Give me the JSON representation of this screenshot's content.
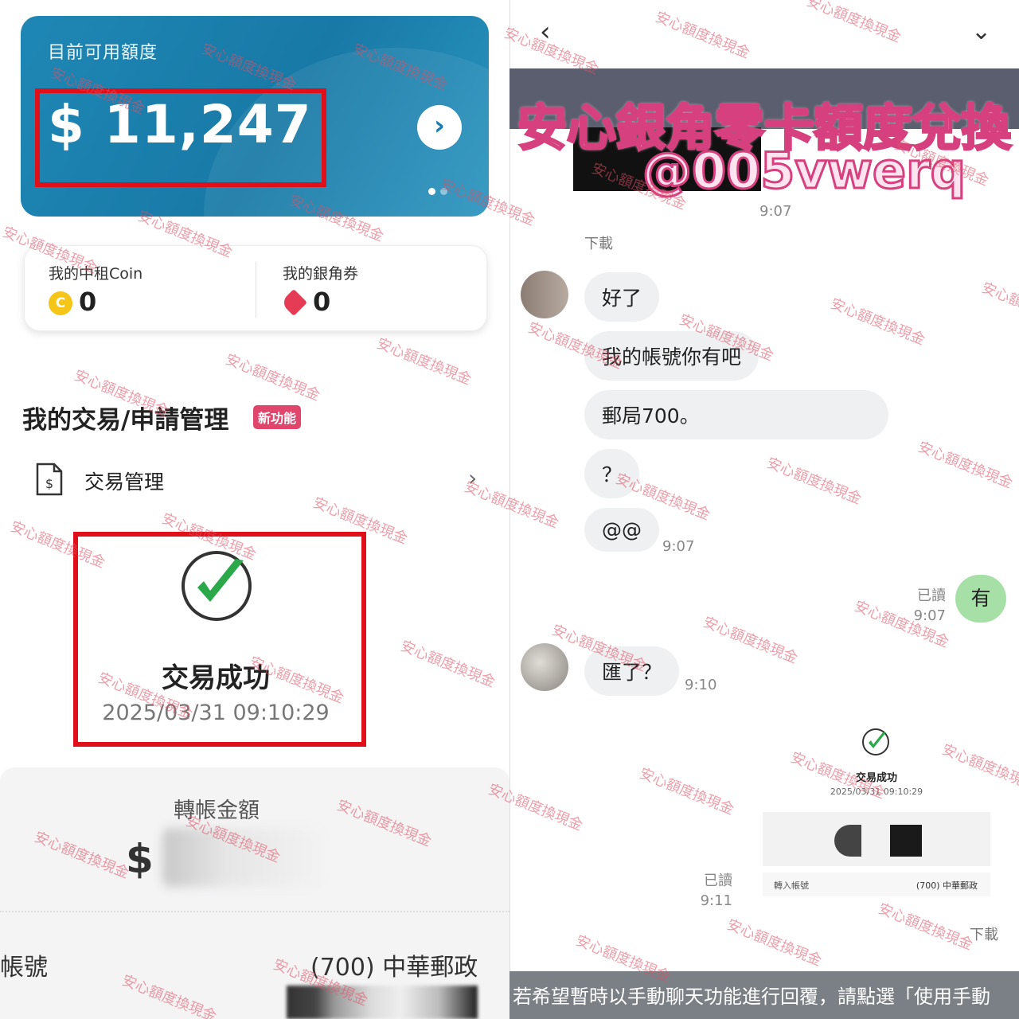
{
  "left": {
    "credit_card": {
      "label": "目前可用額度",
      "amount": "$ 11,247",
      "arrow_glyph": "›"
    },
    "coin": {
      "label": "我的中租Coin",
      "value": "0",
      "icon_glyph": "C"
    },
    "voucher": {
      "label": "我的銀角券",
      "value": "0"
    },
    "section_title": "我的交易/申請管理",
    "new_badge": "新功能",
    "transaction_mgmt": {
      "label": "交易管理",
      "chevron": "›"
    },
    "success": {
      "title": "交易成功",
      "time": "2025/03/31 09:10:29"
    },
    "transfer": {
      "label": "轉帳金額",
      "dollar": "$"
    },
    "account": {
      "label": "帳號",
      "bank": "(700) 中華郵政"
    }
  },
  "right": {
    "nav": {
      "back": "‹",
      "collapse": "⌄"
    },
    "banner": {
      "line1": "安心銀角零卡額度兌換",
      "line2": "@005vwerq"
    },
    "top_time": "9:07",
    "download_1": "下載",
    "messages": [
      {
        "text": "好了"
      },
      {
        "text": "我的帳號你有吧"
      },
      {
        "text": "郵局700。"
      },
      {
        "text": "？"
      },
      {
        "text": "@@",
        "time": "9:07"
      }
    ],
    "my_reply": {
      "read": "已讀",
      "time": "9:07",
      "text": "有"
    },
    "question": {
      "text": "匯了？",
      "time": "9:10"
    },
    "image_msg": {
      "title": "交易成功",
      "date": "2025/03/31 09:10:29",
      "row_label": "轉入帳號",
      "row_value": "(700) 中華郵政",
      "read": "已讀",
      "time": "9:11"
    },
    "download_2": "下載",
    "footer_text": "若希望暫時以手動聊天功能進行回覆，請點選「使用手動"
  },
  "watermark_text": "安心額度換現金",
  "colors": {
    "card_blue": "#1f87b5",
    "highlight_red": "#e0101a",
    "badge_pink": "#e0466c",
    "check_green": "#2aa84a",
    "reply_green": "#a6e0a6"
  }
}
